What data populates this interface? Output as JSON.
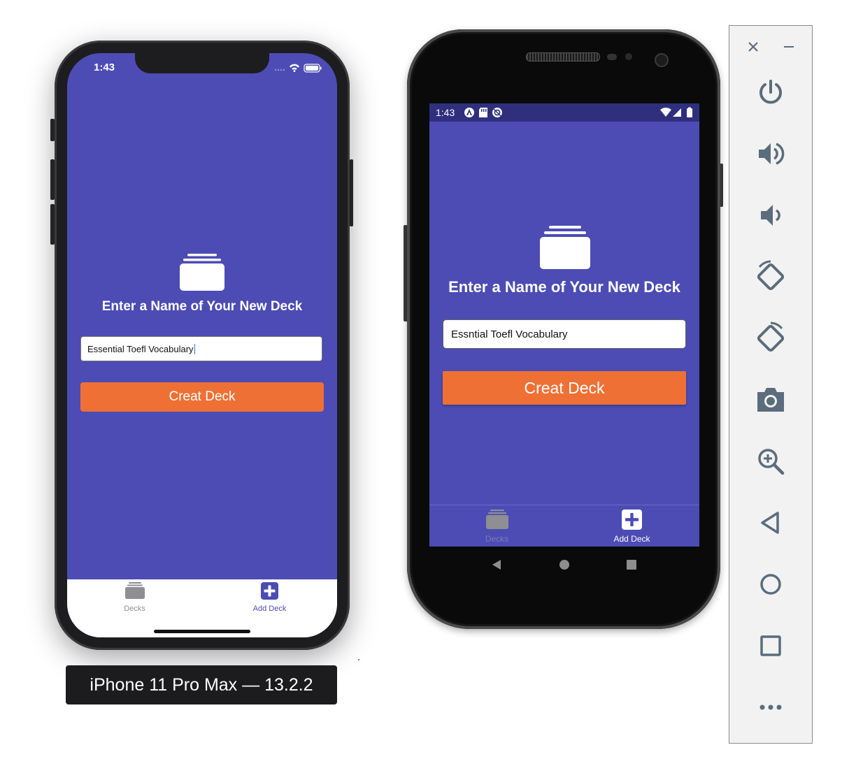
{
  "ios_simulator": {
    "device_label": "iPhone 11 Pro Max — 13.2.2",
    "status_time": "1:43",
    "screen": {
      "title": "Enter a Name of Your New Deck",
      "deck_name_input": "Essential Toefl Vocabulary",
      "create_button": "Creat Deck"
    },
    "tabs": [
      {
        "label": "Decks",
        "icon": "decks-icon",
        "active": false
      },
      {
        "label": "Add Deck",
        "icon": "add-deck-icon",
        "active": true
      }
    ]
  },
  "android_emulator": {
    "status_time": "1:43",
    "screen": {
      "title": "Enter a Name of Your New Deck",
      "deck_name_input": "Essntial Toefl Vocabulary",
      "create_button": "Creat Deck"
    },
    "tabs": [
      {
        "label": "Decks",
        "icon": "decks-icon",
        "active": false
      },
      {
        "label": "Add Deck",
        "icon": "add-deck-icon",
        "active": true
      }
    ],
    "nav_buttons": [
      "back-icon",
      "home-icon",
      "recents-icon"
    ]
  },
  "emulator_toolbar": {
    "items": [
      "close-icon",
      "minimize-icon",
      "power-icon",
      "volume-up-icon",
      "volume-down-icon",
      "rotate-left-icon",
      "rotate-right-icon",
      "camera-icon",
      "zoom-icon",
      "back-icon",
      "home-icon",
      "overview-icon",
      "more-icon"
    ]
  },
  "colors": {
    "app_background": "#4c4cb4",
    "accent_button": "#ef7035",
    "active_tab_ios": "#4c4cb4",
    "inactive_tab": "#8e8e93",
    "toolbar_icon": "#5b6c7c"
  }
}
